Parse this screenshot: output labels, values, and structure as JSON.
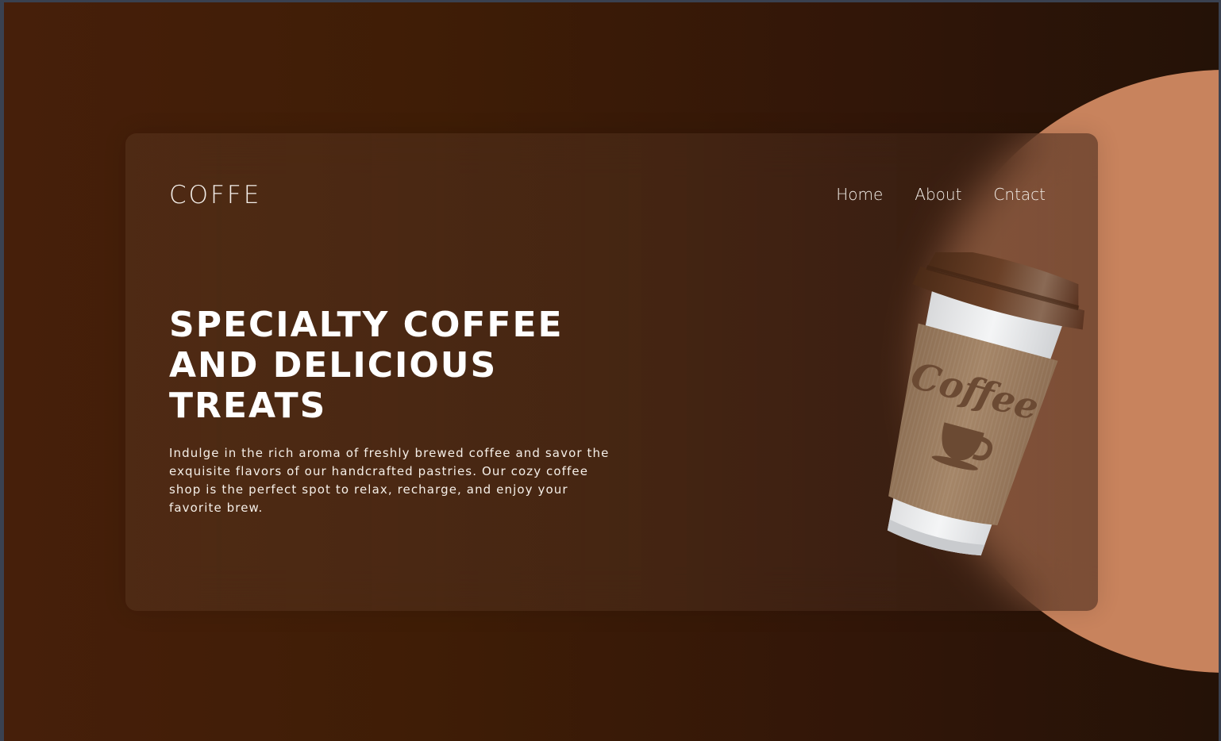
{
  "brand": {
    "logo": "COFFE"
  },
  "nav": {
    "items": [
      "Home",
      "About",
      "Cntact"
    ]
  },
  "hero": {
    "headline_lines": [
      "SPECIALTY COFFEE",
      "AND DELICIOUS",
      "TREATS"
    ],
    "description": "Indulge in the rich aroma of freshly brewed coffee and savor the exquisite flavors of our handcrafted pastries. Our cozy coffee shop is the perfect spot to relax, recharge, and enjoy your favorite brew."
  },
  "cup": {
    "label": "Coffee",
    "icon": "coffee-cup-icon"
  },
  "colors": {
    "background_left": "#461f0a",
    "background_right": "#241207",
    "accent_circle": "#c8835d",
    "text": "#ffffff",
    "cup_lid": "#5b341d",
    "cup_sleeve": "#9b7c5f",
    "cup_body": "#e8e9ea"
  }
}
